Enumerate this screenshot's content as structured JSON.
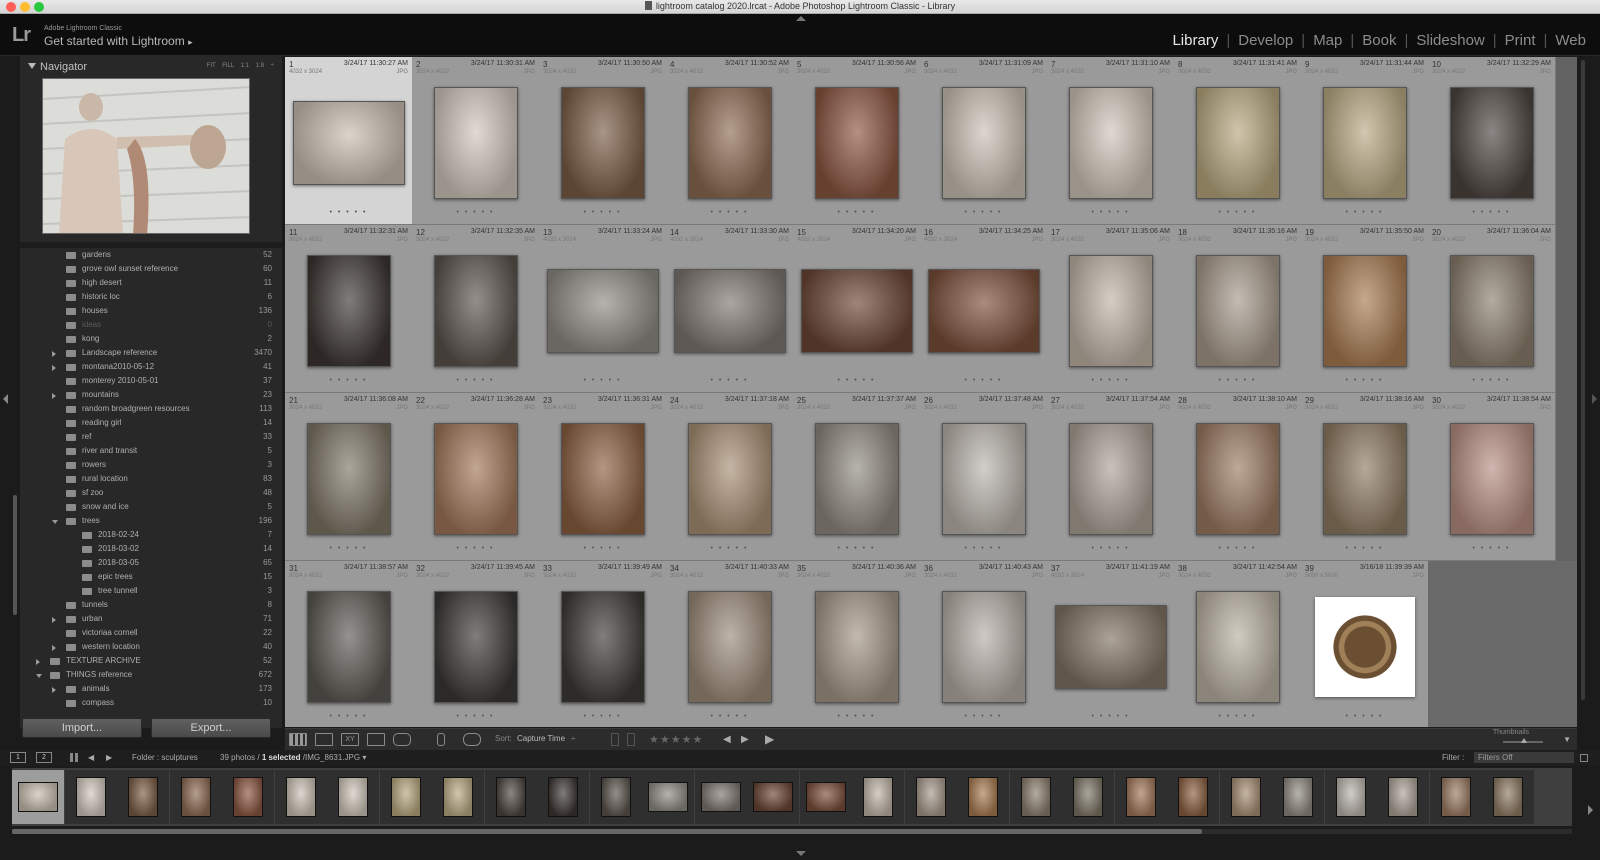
{
  "window": {
    "title": "lightroom catalog 2020.lrcat - Adobe Photoshop Lightroom Classic - Library",
    "traffic_colors": [
      "#fe5f57",
      "#febc2e",
      "#28c840"
    ]
  },
  "identity": {
    "logo": "Lr",
    "app_name": "Adobe Lightroom Classic",
    "tagline": "Get started with Lightroom",
    "tagline_arrow": "▸"
  },
  "modules": [
    "Library",
    "Develop",
    "Map",
    "Book",
    "Slideshow",
    "Print",
    "Web"
  ],
  "active_module": "Library",
  "module_separator": "|",
  "navigator": {
    "title": "Navigator",
    "zoom_options": "FIT FILL 1:1 1:8 ÷"
  },
  "folders": [
    {
      "name": "gardens",
      "count": "52",
      "indent": 1,
      "disclosure": "none"
    },
    {
      "name": "grove owl sunset reference",
      "count": "60",
      "indent": 1,
      "disclosure": "none"
    },
    {
      "name": "high desert",
      "count": "11",
      "indent": 1,
      "disclosure": "none"
    },
    {
      "name": "historic loc",
      "count": "6",
      "indent": 1,
      "disclosure": "none"
    },
    {
      "name": "houses",
      "count": "136",
      "indent": 1,
      "disclosure": "none"
    },
    {
      "name": "ideas",
      "count": "0",
      "indent": 1,
      "disclosure": "none",
      "dim": true
    },
    {
      "name": "kong",
      "count": "2",
      "indent": 1,
      "disclosure": "none"
    },
    {
      "name": "Landscape reference",
      "count": "3470",
      "indent": 1,
      "disclosure": "closed"
    },
    {
      "name": "montana2010-05-12",
      "count": "41",
      "indent": 1,
      "disclosure": "closed"
    },
    {
      "name": "monterey 2010-05-01",
      "count": "37",
      "indent": 1,
      "disclosure": "none"
    },
    {
      "name": "mountains",
      "count": "23",
      "indent": 1,
      "disclosure": "closed"
    },
    {
      "name": "random broadgreen resources",
      "count": "113",
      "indent": 1,
      "disclosure": "none"
    },
    {
      "name": "reading girl",
      "count": "14",
      "indent": 1,
      "disclosure": "none"
    },
    {
      "name": "ref",
      "count": "33",
      "indent": 1,
      "disclosure": "none"
    },
    {
      "name": "river and transit",
      "count": "5",
      "indent": 1,
      "disclosure": "none"
    },
    {
      "name": "rowers",
      "count": "3",
      "indent": 1,
      "disclosure": "none"
    },
    {
      "name": "rural  location",
      "count": "83",
      "indent": 1,
      "disclosure": "none"
    },
    {
      "name": "sf zoo",
      "count": "48",
      "indent": 1,
      "disclosure": "none"
    },
    {
      "name": "snow and ice",
      "count": "5",
      "indent": 1,
      "disclosure": "none"
    },
    {
      "name": "trees",
      "count": "196",
      "indent": 1,
      "disclosure": "open"
    },
    {
      "name": "2018-02-24",
      "count": "7",
      "indent": 2,
      "disclosure": "none"
    },
    {
      "name": "2018-03-02",
      "count": "14",
      "indent": 2,
      "disclosure": "none"
    },
    {
      "name": "2018-03-05",
      "count": "65",
      "indent": 2,
      "disclosure": "none"
    },
    {
      "name": "epic trees",
      "count": "15",
      "indent": 2,
      "disclosure": "none"
    },
    {
      "name": "tree tunnell",
      "count": "3",
      "indent": 2,
      "disclosure": "none"
    },
    {
      "name": "tunnels",
      "count": "8",
      "indent": 1,
      "disclosure": "none"
    },
    {
      "name": "urban",
      "count": "71",
      "indent": 1,
      "disclosure": "closed"
    },
    {
      "name": "victoriaa cornell",
      "count": "22",
      "indent": 1,
      "disclosure": "none"
    },
    {
      "name": "western location",
      "count": "40",
      "indent": 1,
      "disclosure": "closed"
    },
    {
      "name": "TEXTURE ARCHIVE",
      "count": "52",
      "indent": 0,
      "disclosure": "closed"
    },
    {
      "name": "THINGS reference",
      "count": "672",
      "indent": 0,
      "disclosure": "open"
    },
    {
      "name": "animals",
      "count": "173",
      "indent": 1,
      "disclosure": "closed"
    },
    {
      "name": "compass",
      "count": "10",
      "indent": 1,
      "disclosure": "none"
    }
  ],
  "buttons": {
    "import": "Import...",
    "export": "Export..."
  },
  "photos": [
    {
      "n": "1",
      "date": "3/24/17 11:30:27 AM",
      "dims": "4032 x 3024",
      "type": "JPG",
      "o": "l",
      "c": "#c8bdb0",
      "sel": true
    },
    {
      "n": "2",
      "date": "3/24/17 11:30:31 AM",
      "dims": "3024 x 4032",
      "type": "JPG",
      "o": "p",
      "c": "#cfc6bb"
    },
    {
      "n": "3",
      "date": "3/24/17 11:30:50 AM",
      "dims": "3024 x 4032",
      "type": "JPG",
      "o": "p",
      "c": "#7a5c45"
    },
    {
      "n": "4",
      "date": "3/24/17 11:30:52 AM",
      "dims": "3024 x 4032",
      "type": "JPG",
      "o": "p",
      "c": "#8c6a52"
    },
    {
      "n": "5",
      "date": "3/24/17 11:30:56 AM",
      "dims": "3024 x 4032",
      "type": "JPG",
      "o": "p",
      "c": "#8a5540"
    },
    {
      "n": "6",
      "date": "3/24/17 11:31:09 AM",
      "dims": "3024 x 4032",
      "type": "JPG",
      "o": "p",
      "c": "#c9c0b4"
    },
    {
      "n": "7",
      "date": "3/24/17 11:31:10 AM",
      "dims": "3024 x 4032",
      "type": "JPG",
      "o": "p",
      "c": "#cdc4b8"
    },
    {
      "n": "8",
      "date": "3/24/17 11:31:41 AM",
      "dims": "3024 x 4032",
      "type": "JPG",
      "o": "p",
      "c": "#b7a77e"
    },
    {
      "n": "9",
      "date": "3/24/17 11:31:44 AM",
      "dims": "3024 x 4032",
      "type": "JPG",
      "o": "p",
      "c": "#b9a983"
    },
    {
      "n": "10",
      "date": "3/24/17 11:32:29 AM",
      "dims": "3024 x 4032",
      "type": "JPG",
      "o": "p",
      "c": "#4c4540"
    },
    {
      "n": "11",
      "date": "3/24/17 11:32:31 AM",
      "dims": "3024 x 4032",
      "type": "JPG",
      "o": "p",
      "c": "#3c3632"
    },
    {
      "n": "12",
      "date": "3/24/17 11:32:35 AM",
      "dims": "3024 x 4032",
      "type": "JPG",
      "o": "p",
      "c": "#5a534c"
    },
    {
      "n": "13",
      "date": "3/24/17 11:33:24 AM",
      "dims": "4032 x 3024",
      "type": "JPG",
      "o": "l",
      "c": "#8e8a84"
    },
    {
      "n": "14",
      "date": "3/24/17 11:33:30 AM",
      "dims": "4032 x 3024",
      "type": "JPG",
      "o": "l",
      "c": "#7d7670"
    },
    {
      "n": "15",
      "date": "3/24/17 11:34:20 AM",
      "dims": "4032 x 3024",
      "type": "JPG",
      "o": "l",
      "c": "#6a4534"
    },
    {
      "n": "16",
      "date": "3/24/17 11:34:25 AM",
      "dims": "4032 x 3024",
      "type": "JPG",
      "o": "l",
      "c": "#7a4e3a"
    },
    {
      "n": "17",
      "date": "3/24/17 11:35:06 AM",
      "dims": "3024 x 4032",
      "type": "JPG",
      "o": "p",
      "c": "#bfb4a6"
    },
    {
      "n": "18",
      "date": "3/24/17 11:35:16 AM",
      "dims": "3024 x 4032",
      "type": "JPG",
      "o": "p",
      "c": "#a5988a"
    },
    {
      "n": "19",
      "date": "3/24/17 11:35:50 AM",
      "dims": "3024 x 4032",
      "type": "JPG",
      "o": "p",
      "c": "#a77a50"
    },
    {
      "n": "20",
      "date": "3/24/17 11:36:04 AM",
      "dims": "3024 x 4032",
      "type": "JPG",
      "o": "p",
      "c": "#8a7e6c"
    },
    {
      "n": "21",
      "date": "3/24/17 11:36:08 AM",
      "dims": "3024 x 4032",
      "type": "JPG",
      "o": "p",
      "c": "#7d7566"
    },
    {
      "n": "22",
      "date": "3/24/17 11:36:28 AM",
      "dims": "3024 x 4032",
      "type": "JPG",
      "o": "p",
      "c": "#a07658"
    },
    {
      "n": "23",
      "date": "3/24/17 11:36:31 AM",
      "dims": "3024 x 4032",
      "type": "JPG",
      "o": "p",
      "c": "#8a5f40"
    },
    {
      "n": "24",
      "date": "3/24/17 11:37:18 AM",
      "dims": "3024 x 4032",
      "type": "JPG",
      "o": "p",
      "c": "#a78e74"
    },
    {
      "n": "25",
      "date": "3/24/17 11:37:37 AM",
      "dims": "3024 x 4032",
      "type": "JPG",
      "o": "p",
      "c": "#8f8980"
    },
    {
      "n": "26",
      "date": "3/24/17 11:37:48 AM",
      "dims": "3024 x 4032",
      "type": "JPG",
      "o": "p",
      "c": "#b9b3ab"
    },
    {
      "n": "27",
      "date": "3/24/17 11:37:54 AM",
      "dims": "3024 x 4032",
      "type": "JPG",
      "o": "p",
      "c": "#aaa196"
    },
    {
      "n": "28",
      "date": "3/24/17 11:38:10 AM",
      "dims": "3024 x 4032",
      "type": "JPG",
      "o": "p",
      "c": "#9a7a62"
    },
    {
      "n": "29",
      "date": "3/24/17 11:38:16 AM",
      "dims": "3024 x 4032",
      "type": "JPG",
      "o": "p",
      "c": "#8e7a62"
    },
    {
      "n": "30",
      "date": "3/24/17 11:38:54 AM",
      "dims": "3024 x 4032",
      "type": "JPG",
      "o": "p",
      "c": "#b68e82"
    },
    {
      "n": "31",
      "date": "3/24/17 11:38:57 AM",
      "dims": "3024 x 4032",
      "type": "JPG",
      "o": "p",
      "c": "#5b5852"
    },
    {
      "n": "32",
      "date": "3/24/17 11:39:45 AM",
      "dims": "3024 x 4032",
      "type": "JPG",
      "o": "p",
      "c": "#3a3835"
    },
    {
      "n": "33",
      "date": "3/24/17 11:39:49 AM",
      "dims": "3024 x 4032",
      "type": "JPG",
      "o": "p",
      "c": "#3c3a36"
    },
    {
      "n": "34",
      "date": "3/24/17 11:40:33 AM",
      "dims": "3024 x 4032",
      "type": "JPG",
      "o": "p",
      "c": "#9a8a78"
    },
    {
      "n": "35",
      "date": "3/24/17 11:40:36 AM",
      "dims": "3024 x 4032",
      "type": "JPG",
      "o": "p",
      "c": "#a39584"
    },
    {
      "n": "36",
      "date": "3/24/17 11:40:43 AM",
      "dims": "3024 x 4032",
      "type": "JPG",
      "o": "p",
      "c": "#b3aca4"
    },
    {
      "n": "37",
      "date": "3/24/17 11:41:19 AM",
      "dims": "4032 x 3024",
      "type": "JPG",
      "o": "l",
      "c": "#807262"
    },
    {
      "n": "38",
      "date": "3/24/17 11:42:54 AM",
      "dims": "3024 x 4032",
      "type": "JPG",
      "o": "p",
      "c": "#b8b0a2"
    },
    {
      "n": "39",
      "date": "3/16/18 11:39:39 AM",
      "dims": "5000 x 5000",
      "type": "JPG",
      "o": "s",
      "c": "#6b4f32",
      "white": true
    }
  ],
  "toolbar": {
    "sort_label": "Sort:",
    "sort_value": "Capture Time",
    "sort_arrow": "÷",
    "stars": "★★★★★",
    "thumbnails_label": "Thumbnails"
  },
  "filmbar": {
    "screen1": "1",
    "screen2": "2",
    "folder_text": "Folder : sculptures",
    "photo_count": "39 photos",
    "selected": "1 selected",
    "filename": "/IMG_8631.JPG ▾",
    "filter_label": "Filter :",
    "filter_value": "Filters Off"
  },
  "filmstrip_count": 29
}
